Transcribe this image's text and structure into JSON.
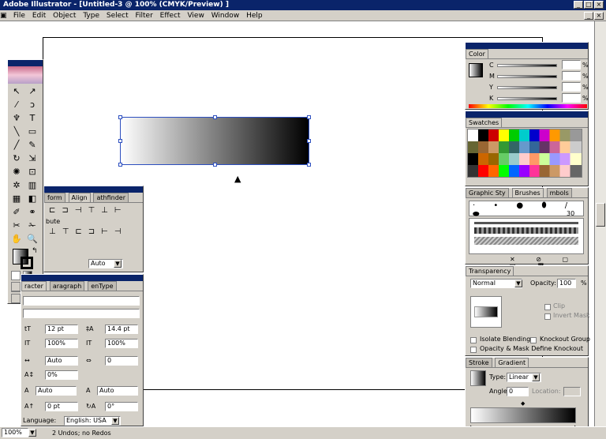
{
  "window": {
    "title": "Adobe Illustrator - [Untitled-3 @ 100% (CMYK/Preview) ]",
    "controls": [
      "_",
      "□",
      "×"
    ]
  },
  "menu": [
    "File",
    "Edit",
    "Object",
    "Type",
    "Select",
    "Filter",
    "Effect",
    "View",
    "Window",
    "Help"
  ],
  "color_panel": {
    "tab": "Color",
    "channels": [
      "C",
      "M",
      "Y",
      "K"
    ],
    "unit": "%"
  },
  "swatches_panel": {
    "tab": "Swatches"
  },
  "brushes_panel": {
    "tabs": [
      "Graphic Sty",
      "Brushes",
      "mbols"
    ],
    "size_label": "30"
  },
  "transparency_panel": {
    "tab": "Transparency",
    "mode": "Normal",
    "opacity_label": "Opacity:",
    "opacity_value": "100",
    "unit": "%",
    "clip": "Clip",
    "invert_mask": "Invert Mask",
    "isolate_blending": "Isolate Blending",
    "knockout_group": "Knockout Group",
    "opacity_mask_shape": "Opacity & Mask Define Knockout Shape"
  },
  "gradient_panel": {
    "tabs": [
      "Stroke",
      "Gradient"
    ],
    "type_label": "Type:",
    "type_value": "Linear",
    "angle_label": "Angle:",
    "angle_value": "0",
    "location_label": "Location:"
  },
  "align_panel": {
    "tabs": [
      "form",
      "Align",
      "athfinder"
    ],
    "distribute_label": "bute",
    "auto": "Auto"
  },
  "character_panel": {
    "tabs": [
      "racter",
      "aragraph",
      "enType"
    ],
    "font_size": "12 pt",
    "leading": "14.4 pt",
    "h_scale": "100%",
    "v_scale": "100%",
    "kerning": "Auto",
    "tracking": "0",
    "baseline": "0%",
    "auto1": "Auto",
    "auto2": "Auto",
    "shift": "0 pt",
    "rotate": "0°",
    "language_label": "Language:",
    "language": "English: USA"
  },
  "status": {
    "zoom": "100%",
    "undos": "2 Undos; no Redos"
  }
}
